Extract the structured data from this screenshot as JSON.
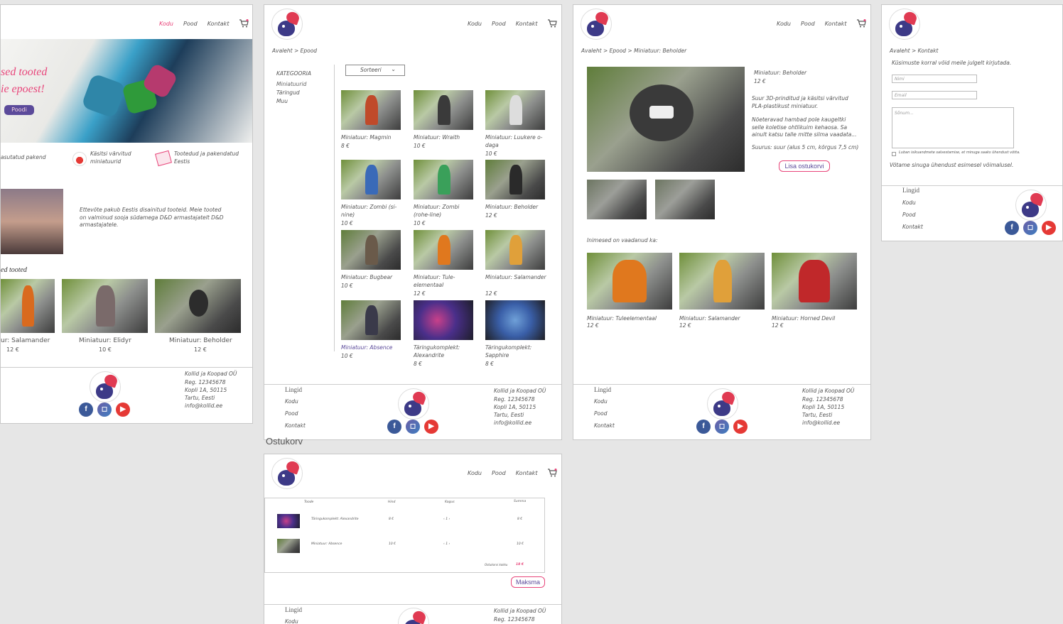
{
  "artboard_labels": {
    "cart": "Ostukorv"
  },
  "nav": {
    "home": "Kodu",
    "shop": "Pood",
    "contact": "Kontakt"
  },
  "home": {
    "hero_line1": "sed tooted",
    "hero_line2": "ie epoest!",
    "hero_button": "Poodi",
    "feature1": "asutatud pakend",
    "feature2": "Käsitsi värvitud miniatuurid",
    "feature3": "Tootedud ja pakendatud Eestis",
    "about": "Ettevõte pakub Eestis disainitud tooteid. Meie tooted on valminud sooja südamega D&D armastajatelt D&D armastajatele.",
    "section_title": "ed tooted",
    "products": [
      {
        "name": "ur: Salamander",
        "price": "12 €"
      },
      {
        "name": "Miniatuur: Elidyr",
        "price": "10 €"
      },
      {
        "name": "Miniatuur: Beholder",
        "price": "12 €"
      }
    ]
  },
  "company": {
    "name": "Kollid ja Koopad OÜ",
    "reg": "Reg. 12345678",
    "address": "Kopli 1A, 50115",
    "city": "Tartu, Eesti",
    "email": "info@kollid.ee"
  },
  "links": {
    "title": "Lingid",
    "home": "Kodu",
    "shop": "Pood",
    "contact": "Kontakt"
  },
  "shop": {
    "breadcrumb": "Avaleht > Epood",
    "sort": "Sorteeri",
    "categories_title": "KATEGOORIA",
    "categories": [
      "Miniatuurid",
      "Täringud",
      "Muu"
    ],
    "products": [
      {
        "name": "Miniatuur: Magmin",
        "price": "8 €"
      },
      {
        "name": "Miniatuur: Wraith",
        "price": "10 €"
      },
      {
        "name": "Miniatuur: Luukere o-daga",
        "price": "10 €"
      },
      {
        "name": "Miniatuur: Zombi (si-nine)",
        "price": "10 €"
      },
      {
        "name": "Miniatuur: Zombi (rohe-line)",
        "price": "10 €"
      },
      {
        "name": "Miniatuur: Beholder",
        "price": "12 €"
      },
      {
        "name": "Miniatuur: Bugbear",
        "price": "10 €"
      },
      {
        "name": "Miniatuur: Tule-elementaal",
        "price": "12 €"
      },
      {
        "name": "Miniatuur: Salamander",
        "price": "12 €"
      },
      {
        "name": "Miniatuur: Absence",
        "price": "10 €"
      },
      {
        "name": "Täringukomplekt: Alexandrite",
        "price": "8 €"
      },
      {
        "name": "Täringukomplekt: Sapphire",
        "price": "8 €"
      }
    ]
  },
  "product": {
    "breadcrumb": "Avaleht > Epood > Miniatuur: Beholder",
    "title": "Miniatuur: Beholder",
    "price": "12 €",
    "desc1": "Suur 3D-prinditud ja käsitsi värvitud PLA-plastikust miniatuur.",
    "desc2": "Nõeteravad hambad pole kaugeltki selle koletise ohtlikuim kehaosa. Sa ainult katsu talle mitte silma vaadata...",
    "size": "Suurus: suur (alus 5 cm, kõrgus 7,5 cm)",
    "add_to_cart": "Lisa ostukorvi",
    "related_title": "Inimesed on vaadanud ka:",
    "related": [
      {
        "name": "Miniatuur: Tuleelementaal",
        "price": "12 €"
      },
      {
        "name": "Miniatuur: Salamander",
        "price": "12 €"
      },
      {
        "name": "Miniatuur: Horned Devil",
        "price": "12 €"
      }
    ]
  },
  "contact": {
    "breadcrumb": "Avaleht > Kontakt",
    "intro": "Küsimuste korral võid meile julgelt kirjutada.",
    "name_placeholder": "Nimi",
    "email_placeholder": "Email",
    "message_placeholder": "Sõnum...",
    "consent": "Luban isikuandmete salvestamise, et minuga saaks ühendust võtta.",
    "confirmation": "Võtame sinuga ühendust esimesel võimalusel."
  },
  "cart": {
    "col_product": "Toode",
    "col_price": "Hind",
    "col_qty": "Kogus",
    "col_sum": "Summa",
    "rows": [
      {
        "name": "Täringukomplekt: Alexandrite",
        "price": "8 €",
        "qty": "1",
        "sum": "8 €"
      },
      {
        "name": "Miniatuur: Absence",
        "price": "10 €",
        "qty": "1",
        "sum": "10 €"
      }
    ],
    "total_label": "Ostukorvi kokku",
    "total": "18 €",
    "pay": "Maksma"
  },
  "colors": {
    "accent": "#e8457a",
    "brand": "#5b4a9a",
    "footer_icons": [
      "#3b5998",
      "#3f7dbf",
      "#e53935"
    ]
  },
  "icons": [
    "cart-icon",
    "facebook-icon",
    "instagram-icon",
    "youtube-icon",
    "logo-icon"
  ]
}
